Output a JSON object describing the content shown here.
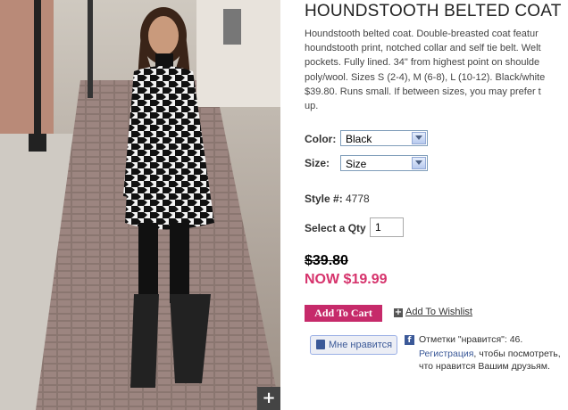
{
  "product": {
    "title": "HOUNDSTOOTH BELTED COAT",
    "description_lines": [
      "Houndstooth belted coat. Double-breasted coat featur",
      "houndstooth print, notched collar and self tie belt. Welt",
      "pockets. Fully lined. 34\" from highest point on shoulde",
      "poly/wool. Sizes S (2-4), M (6-8), L (10-12). Black/white",
      "$39.80. Runs small. If between sizes, you may prefer t",
      "up."
    ],
    "color_label": "Color:",
    "color_value": "Black",
    "size_label": "Size:",
    "size_value": "Size",
    "style_label": "Style #:",
    "style_value": "4778",
    "qty_label": "Select a Qty",
    "qty_value": "1",
    "old_price": "$39.80",
    "new_price": "NOW $19.99",
    "add_to_cart": "Add To Cart",
    "add_to_wishlist": "Add To Wishlist",
    "wish_icon": "+"
  },
  "facebook": {
    "like_button": "Мне нравится",
    "count_text": "Отметки \"нравится\": 46.",
    "register_link": "Регистрация",
    "line2_rest": ", чтобы посмотреть,",
    "line3": "что нравится Вашим друзьям."
  },
  "zoom_icon": "+",
  "colors": {
    "accent": "#c62a6a",
    "sale": "#d6336c",
    "fb": "#3b5998"
  }
}
